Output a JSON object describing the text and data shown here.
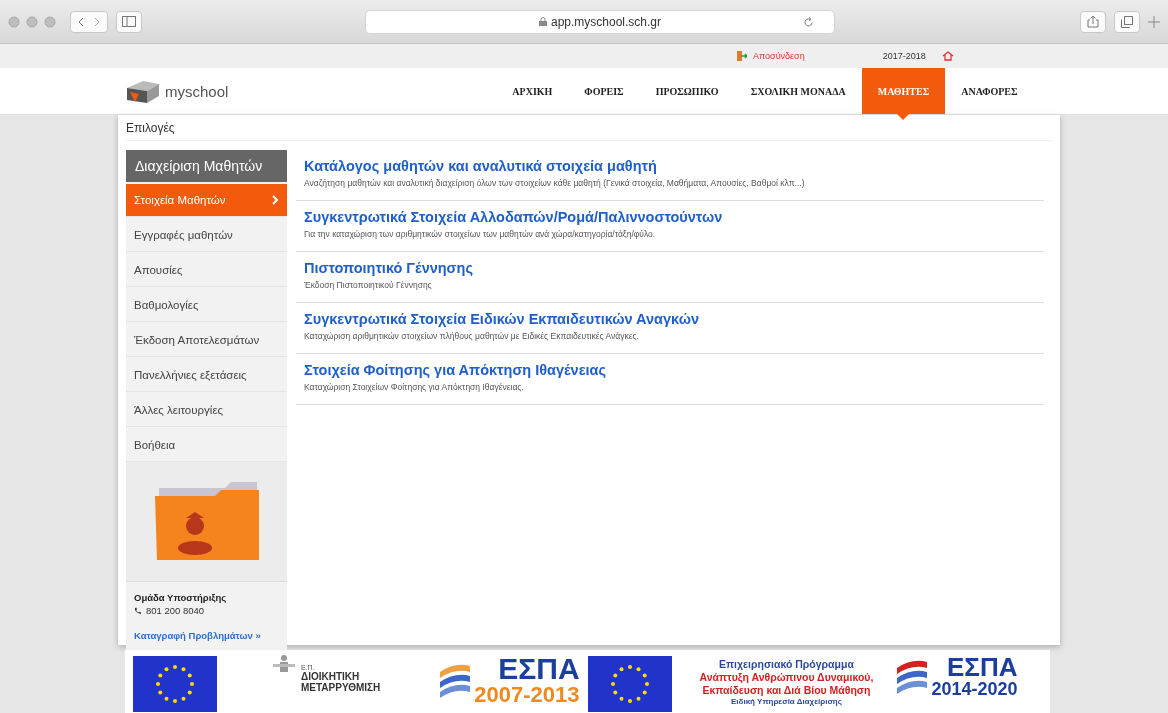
{
  "browser": {
    "url": "app.myschool.sch.gr"
  },
  "top_bar": {
    "logout": "Αποσύνδεση",
    "school_year": "2017-2018"
  },
  "header": {
    "logo": "myschool",
    "nav": [
      {
        "label": "ΑΡΧΙΚΗ",
        "selected": false
      },
      {
        "label": "ΦΟΡΕΙΣ",
        "selected": false
      },
      {
        "label": "ΠΡΟΣΩΠΙΚΟ",
        "selected": false
      },
      {
        "label": "ΣΧΟΛΙΚΗ ΜΟΝΑΔΑ",
        "selected": false
      },
      {
        "label": "ΜΑΘΗΤΕΣ",
        "selected": true
      },
      {
        "label": "ΑΝΑΦΟΡΕΣ",
        "selected": false
      }
    ]
  },
  "page": {
    "title": "Επιλογές"
  },
  "sidebar": {
    "title": "Διαχείριση Μαθητών",
    "items": [
      {
        "label": "Στοιχεία Μαθητών",
        "selected": true
      },
      {
        "label": "Εγγραφές μαθητών",
        "selected": false
      },
      {
        "label": "Απουσίες",
        "selected": false
      },
      {
        "label": "Βαθμολογίες",
        "selected": false
      },
      {
        "label": "Έκδοση Αποτελεσμάτων",
        "selected": false
      },
      {
        "label": "Πανελλήνιες εξετάσεις",
        "selected": false
      },
      {
        "label": "Άλλες λειτουργίες",
        "selected": false
      },
      {
        "label": "Βοήθεια",
        "selected": false
      }
    ],
    "support": {
      "title": "Ομάδα Υποστήριξης",
      "phone": "801 200 8040",
      "link": "Καταγραφή Προβλημάτων »"
    }
  },
  "options": [
    {
      "title": "Κατάλογος μαθητών και αναλυτικά στοιχεία μαθητή",
      "description": "Αναζήτηση μαθητών και αναλυτική διαχείριση όλων των στοιχείων κάθε μαθητή (Γενικά στοιχεία, Μαθήματα, Απουσίες, Βαθμοί κλπ...)"
    },
    {
      "title": "Συγκεντρωτικά Στοιχεία Αλλοδαπών/Ρομά/Παλιννοστούντων",
      "description": "Για την καταχώριση των αριθμητικών στοιχείων των μαθητών ανά χώρα/κατηγορία/τάξη/φύλο."
    },
    {
      "title": "Πιστοποιητικό Γέννησης",
      "description": "Έκδοση Πιστοποιητικού Γέννησης"
    },
    {
      "title": "Συγκεντρωτικά Στοιχεία Ειδικών Εκπαιδευτικών Αναγκών",
      "description": "Καταχώριση αριθμητικών στοιχείων πλήθους μαθητών με Ειδικές Εκπαιδευτικές Ανάγκες."
    },
    {
      "title": "Στοιχεία Φοίτησης για Απόκτηση Ιθαγένειας",
      "description": "Καταχώριση Στοιχείων Φοίτησης για Απόκτηση Ιθαγένειας."
    }
  ],
  "footer": {
    "reform": {
      "prefix": "Ε.Π.",
      "line_1": "ΔΙΟΙΚΗΤΙΚΗ",
      "line_2": "ΜΕΤΑΡΡΥΘΜΙΣΗ"
    },
    "espa_old": {
      "name": "ΕΣΠΑ",
      "period": "2007-2013"
    },
    "programme": {
      "line_1": "Επιχειρησιακό Πρόγραμμα",
      "line_2": "Ανάπτυξη Ανθρώπινου Δυναμικού,",
      "line_3": "Εκπαίδευση και Διά Βίου Μάθηση",
      "line_4": "Ειδική Υπηρεσία Διαχείρισης"
    },
    "espa_new": {
      "name": "ΕΣΠΑ",
      "period": "2014-2020"
    }
  }
}
